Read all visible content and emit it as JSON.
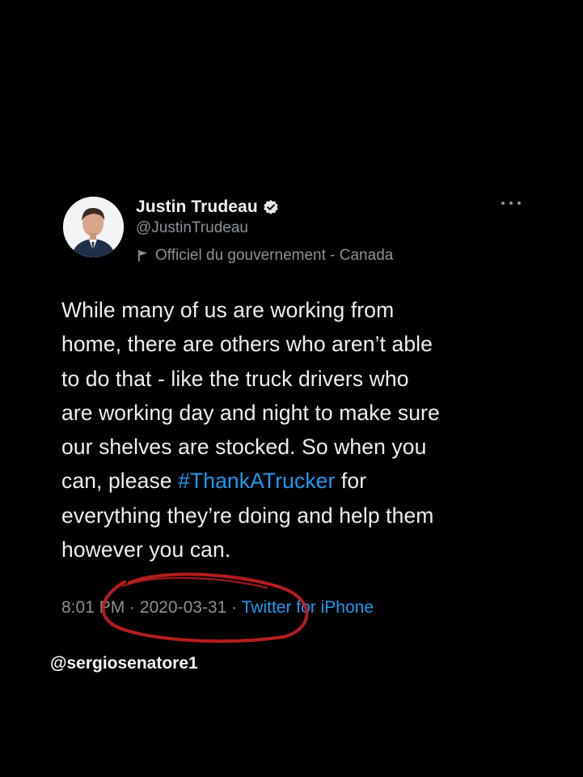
{
  "tweet": {
    "author": {
      "display_name": "Justin Trudeau",
      "handle": "@JustinTrudeau",
      "label": "Officiel du gouvernement - Canada",
      "verified": true
    },
    "text_lines": [
      "While many of us are working from",
      "home, there are others who aren’t able",
      "to do that - like the truck drivers who",
      "are working day and night to make sure",
      "our shelves are stocked. So when you",
      "can, please ",
      "everything they’re doing and help them",
      "however you can."
    ],
    "hashtag": "#ThankATrucker",
    "after_hashtag": " for",
    "meta": {
      "time": "8:01 PM",
      "separator": " · ",
      "date": "2020-03-31",
      "source": "Twitter for iPhone"
    }
  },
  "watermark": "@sergiosenatore1",
  "icons": {
    "verified": "verified-badge-icon",
    "label": "flag-icon",
    "more": "more-options-icon"
  },
  "colors": {
    "background": "#000000",
    "hashtag": "#1d9bf0",
    "secondary_text": "#8b9197",
    "annotation_circle": "#c42020"
  }
}
